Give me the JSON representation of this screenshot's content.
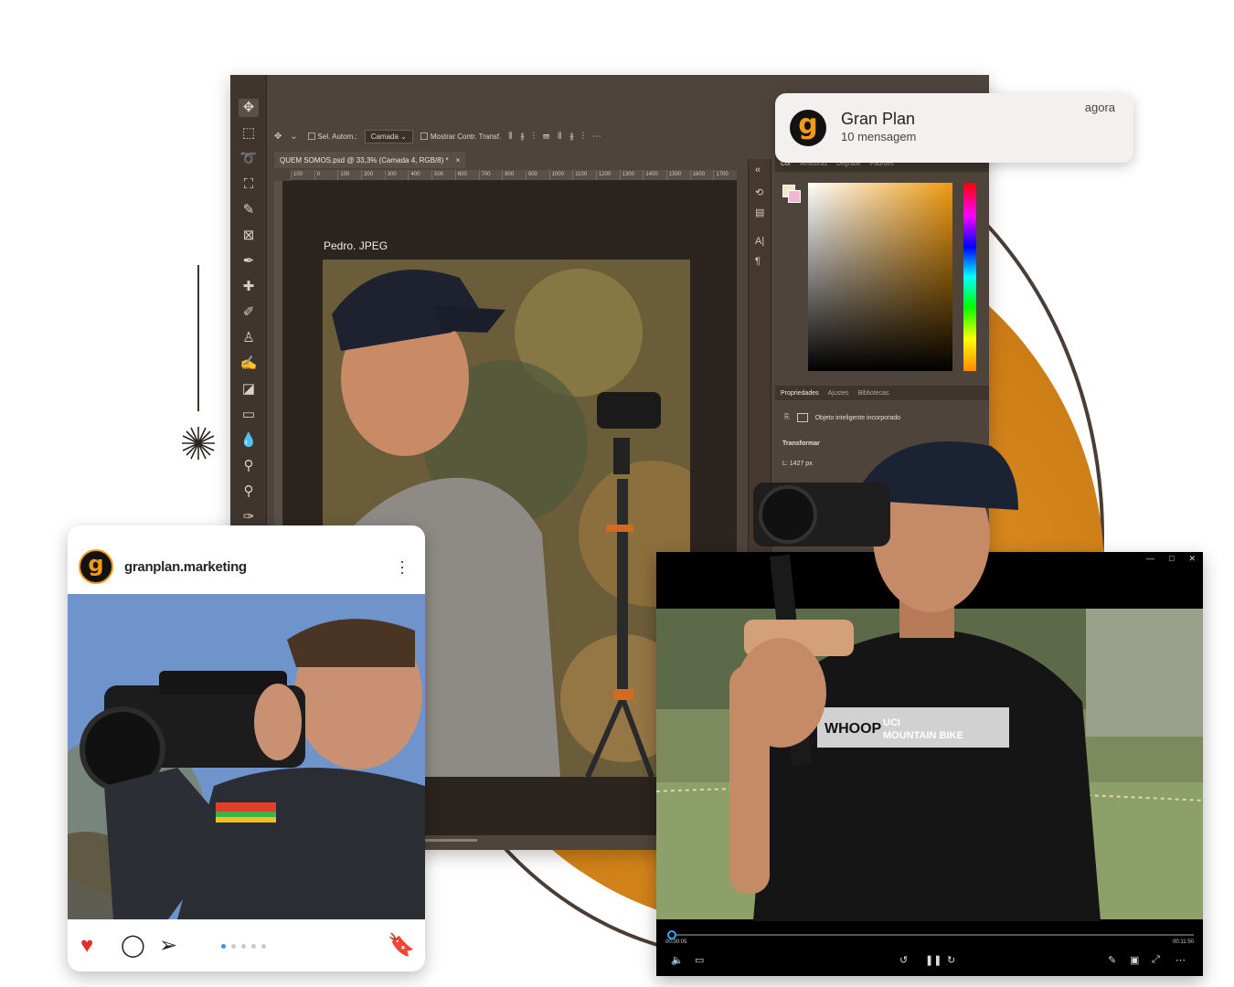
{
  "photoshop": {
    "options": {
      "auto_select": "Sel. Autom.:",
      "layer_select": "Camada",
      "show_transform": "Mostrar Contr. Transf."
    },
    "doc_tab": "QUEM SOMOS.psd @ 33,3% (Camada 4, RGB/8) *",
    "ruler_ticks": [
      "100",
      "0",
      "100",
      "200",
      "300",
      "400",
      "500",
      "600",
      "700",
      "800",
      "900",
      "1000",
      "1100",
      "1200",
      "1300",
      "1400",
      "1500",
      "1600",
      "1700"
    ],
    "layer_label": "Pedro. JPEG",
    "color_tabs": [
      "Cor",
      "Amostras",
      "Degradê",
      "Padrões"
    ],
    "property_tabs": [
      "Propriedades",
      "Ajustes",
      "Bibliotecas"
    ],
    "smart_object": "Objeto inteligente incorporado",
    "transform": "Transformar",
    "width": "L:   1427 px"
  },
  "notification": {
    "app": "Gran Plan",
    "message": "10 mensagem",
    "time": "agora"
  },
  "instagram": {
    "username": "granplan.marketing",
    "carousel_count": 5,
    "carousel_active": 0
  },
  "player": {
    "current_time": "00:00:05",
    "duration": "00:11:50",
    "progress": 0.01
  },
  "colors": {
    "brand_orange": "#f39a12",
    "ps_bg": "#4e443b",
    "like_red": "#e0302a"
  }
}
